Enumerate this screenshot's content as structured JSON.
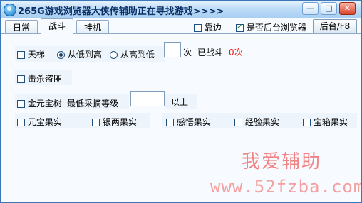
{
  "window": {
    "title": "265G游戏浏览器大侠传辅助正在寻找游戏>>>>"
  },
  "tabs": [
    {
      "label": "日常"
    },
    {
      "label": "战斗",
      "active": true
    },
    {
      "label": "挂机"
    }
  ],
  "header_options": {
    "dock": {
      "label": "靠边",
      "checked": false
    },
    "background_browser": {
      "label": "是否后台浏览器",
      "checked": true
    },
    "background_button": "后台/F8"
  },
  "ladder": {
    "label": "天梯",
    "low_to_high": "从低到高",
    "high_to_low": "从高到低",
    "selected": "low_to_high",
    "count_value": "",
    "times_label": "次",
    "fought_label": "已战斗",
    "fought_count": "0次"
  },
  "kill_bandits": {
    "label": "击杀盗匪"
  },
  "gold_treasure": {
    "label": "金元宝树",
    "min_level_label": "最低采摘等级",
    "min_level_value": "",
    "above_label": "以上"
  },
  "fruits": [
    {
      "label": "元宝果实"
    },
    {
      "label": "银两果实"
    },
    {
      "label": "感悟果实"
    },
    {
      "label": "经验果实"
    },
    {
      "label": "宝箱果实"
    }
  ],
  "watermark": {
    "line1": "我爱辅助",
    "line2": "www.52fzba.com"
  }
}
